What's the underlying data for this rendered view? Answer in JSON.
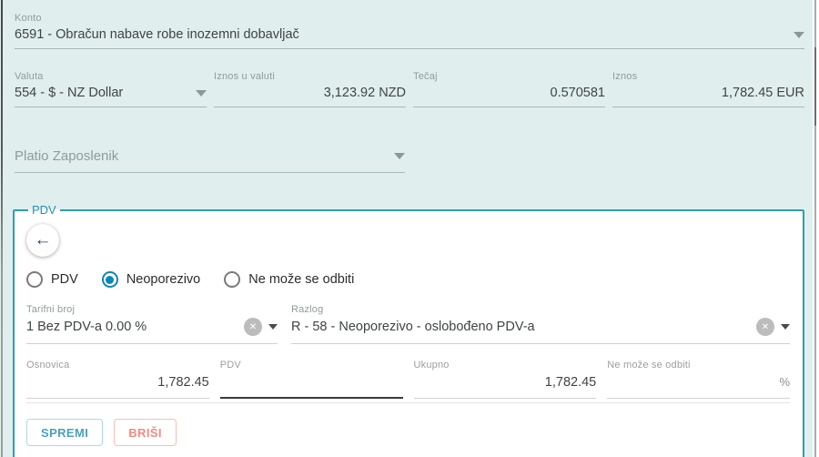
{
  "form": {
    "konto": {
      "label": "Konto",
      "value": "6591 - Obračun nabave robe inozemni dobavljač"
    },
    "valuta": {
      "label": "Valuta",
      "value": "554 - $ - NZ Dollar"
    },
    "iznos_u_valuti": {
      "label": "Iznos u valuti",
      "value": "3,123.92 NZD"
    },
    "tecaj": {
      "label": "Tečaj",
      "value": "0.570581"
    },
    "iznos": {
      "label": "Iznos",
      "value": "1,782.45 EUR"
    },
    "platio": {
      "label": "Platio Zaposlenik",
      "value": ""
    },
    "pdv_section": {
      "legend": "PDV",
      "radios": [
        {
          "label": "PDV",
          "selected": false
        },
        {
          "label": "Neoporezivo",
          "selected": true
        },
        {
          "label": "Ne može se odbiti",
          "selected": false
        }
      ],
      "tarifni_broj": {
        "label": "Tarifni broj",
        "value": "1 Bez PDV-a 0.00 %"
      },
      "razlog": {
        "label": "Razlog",
        "value": "R - 58 - Neoporezivo - oslobođeno PDV-a"
      },
      "osnovica": {
        "label": "Osnovica",
        "value": "1,782.45"
      },
      "pdv": {
        "label": "PDV",
        "value": ""
      },
      "ukupno": {
        "label": "Ukupno",
        "value": "1,782.45"
      },
      "ne_moze_se_odbiti": {
        "label": "Ne može se odbiti",
        "value": "",
        "suffix": "%"
      },
      "buttons": {
        "save": "SPREMI",
        "delete": "BRIŠI"
      }
    }
  },
  "icons": {
    "back_arrow": "←",
    "clear": "✕"
  },
  "colors": {
    "background": "#e0efed",
    "accent_teal": "#2e9cba",
    "radio_selected": "#0d87b5",
    "save_button": "#4ba0bf",
    "delete_button": "#f28b80",
    "focused_underline": "#3a3a3a"
  }
}
